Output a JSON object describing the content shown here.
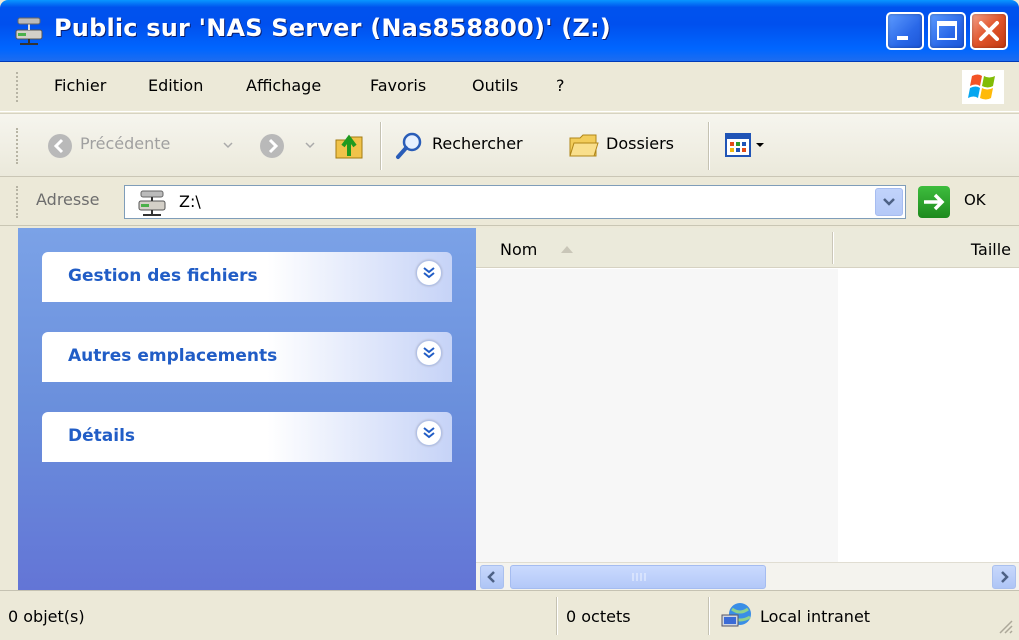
{
  "window": {
    "title": "Public sur 'NAS Server (Nas858800)' (Z:)"
  },
  "menu": {
    "items": [
      "Fichier",
      "Edition",
      "Affichage",
      "Favoris",
      "Outils",
      "?"
    ]
  },
  "toolbar": {
    "back_label": "Précédente",
    "search_label": "Rechercher",
    "folders_label": "Dossiers"
  },
  "address": {
    "label": "Adresse",
    "value": "Z:\\",
    "go_label": "OK"
  },
  "taskpane": {
    "sections": [
      "Gestion des fichiers",
      "Autres emplacements",
      "Détails"
    ]
  },
  "filelist": {
    "columns": [
      "Nom",
      "Taille"
    ],
    "sorted_column": "Nom",
    "rows": []
  },
  "status": {
    "objects": "0 objet(s)",
    "size": "0 octets",
    "zone": "Local intranet"
  },
  "colors": {
    "titlebar": "#0054e3",
    "taskpane": "#6f90dc",
    "task_title": "#215dc6"
  }
}
